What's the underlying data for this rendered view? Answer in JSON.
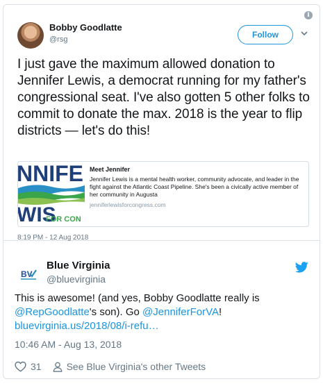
{
  "quoted_tweet": {
    "display_name": "Bobby Goodlatte",
    "handle": "@rsg",
    "follow_label": "Follow",
    "text": "I just gave the maximum allowed donation to Jennifer Lewis, a democrat running for my father's congressional seat. I've also gotten 5 other folks to commit to donate the max. 2018 is the year to flip districts — let's do this!",
    "timestamp": "8:19 PM - 12 Aug 2018",
    "link_card": {
      "image_text_top": "NNIFE",
      "image_text_bottom": "WIS",
      "image_text_small": "FOR CON",
      "title": "Meet Jennifer",
      "description": "Jennifer Lewis is a mental health worker, community advocate, and leader in the fight against the Atlantic Coast Pipeline. She's been a civically active member of her community in Augusta",
      "url": "jenniferlewisforcongress.com"
    }
  },
  "tweet": {
    "display_name": "Blue Virginia",
    "handle": "@bluevirginia",
    "avatar_text": "BV",
    "text_before": "This is awesome! (and yes, Bobby Goodlatte really is ",
    "mention_1": "@RepGoodlatte",
    "text_middle": "'s son). Go ",
    "mention_2": "@JenniferForVA",
    "text_after": "!",
    "link": "bluevirginia.us/2018/08/i-refu…",
    "timestamp": "10:46 AM - Aug 13, 2018",
    "like_count": "31",
    "other_tweets_label": "See Blue Virginia's other Tweets"
  },
  "colors": {
    "link_blue": "#1b95e0",
    "muted_gray": "#657786",
    "border": "#dbe1e6",
    "twitter_blue": "#1da1f2"
  },
  "icons": [
    "info-icon",
    "chevron-down-icon",
    "twitter-bird-icon",
    "heart-icon",
    "person-icon"
  ]
}
